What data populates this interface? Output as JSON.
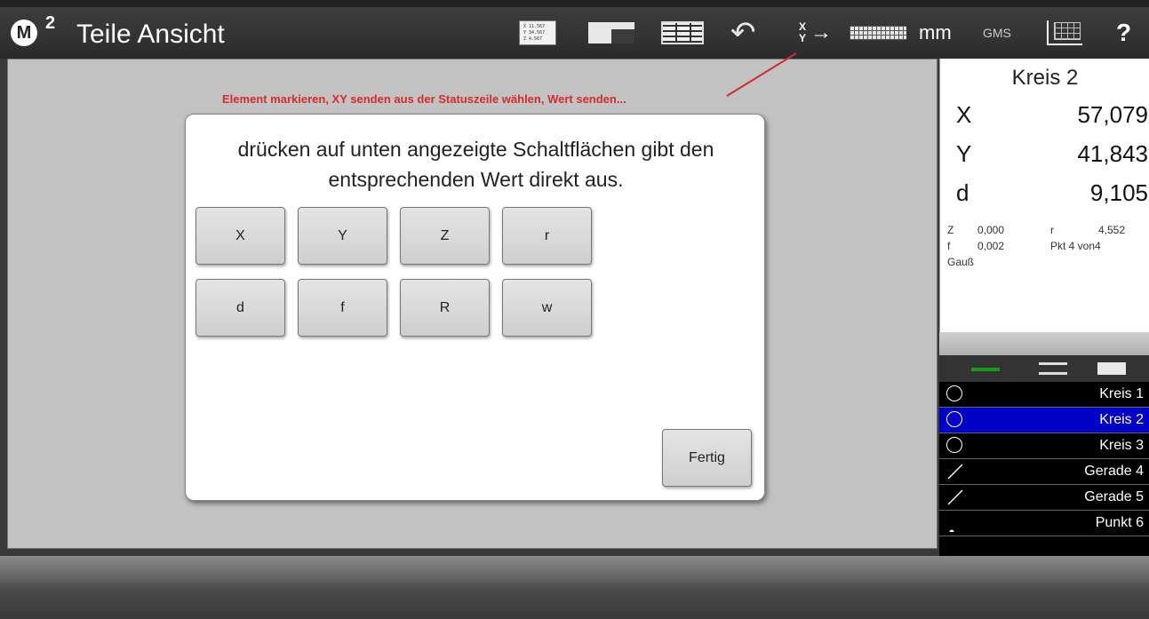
{
  "titlebar": {
    "logo_letter": "M",
    "logo_superscript": "2",
    "title": "Teile Ansicht",
    "list_icon_lines": [
      "X  11.567",
      "Y  34.567",
      "Z   4.567"
    ],
    "xy_top": "X",
    "xy_bottom": "Y",
    "xy_arrow": "→",
    "unit": "mm",
    "angle_format": "GMS",
    "help": "?"
  },
  "hint": "Element markieren, XY senden aus der Statuszeile wählen, Wert senden...",
  "dialog": {
    "message": "drücken auf unten angezeigte Schaltflächen gibt den entsprechenden Wert direkt aus.",
    "buttons": [
      "X",
      "Y",
      "Z",
      "r",
      "d",
      "f",
      "R",
      "w"
    ],
    "done_label": "Fertig"
  },
  "right_panel": {
    "title": "Kreis 2",
    "rows": [
      {
        "label": "X",
        "value": "57,079"
      },
      {
        "label": "Y",
        "value": "41,843"
      },
      {
        "label": "d",
        "value": "9,105"
      }
    ],
    "small": {
      "z_label": "Z",
      "z_value": "0,000",
      "r_label": "r",
      "r_value": "4,552",
      "f_label": "f",
      "f_value": "0,002",
      "pkt": "Pkt 4 von4",
      "method": "Gauß"
    }
  },
  "elements": [
    {
      "label": "Kreis 1",
      "icon": "circle-icon",
      "selected": false
    },
    {
      "label": "Kreis 2",
      "icon": "circle-icon",
      "selected": true
    },
    {
      "label": "Kreis 3",
      "icon": "circle-icon",
      "selected": false
    },
    {
      "label": "Gerade 4",
      "icon": "line-icon",
      "selected": false
    },
    {
      "label": "Gerade 5",
      "icon": "line-icon",
      "selected": false
    },
    {
      "label": "Punkt 6",
      "icon": "point-icon",
      "selected": false
    }
  ],
  "colors": {
    "hint": "#d52b2b",
    "selection": "#0000c8",
    "tab_active": "#1a9a1a"
  }
}
